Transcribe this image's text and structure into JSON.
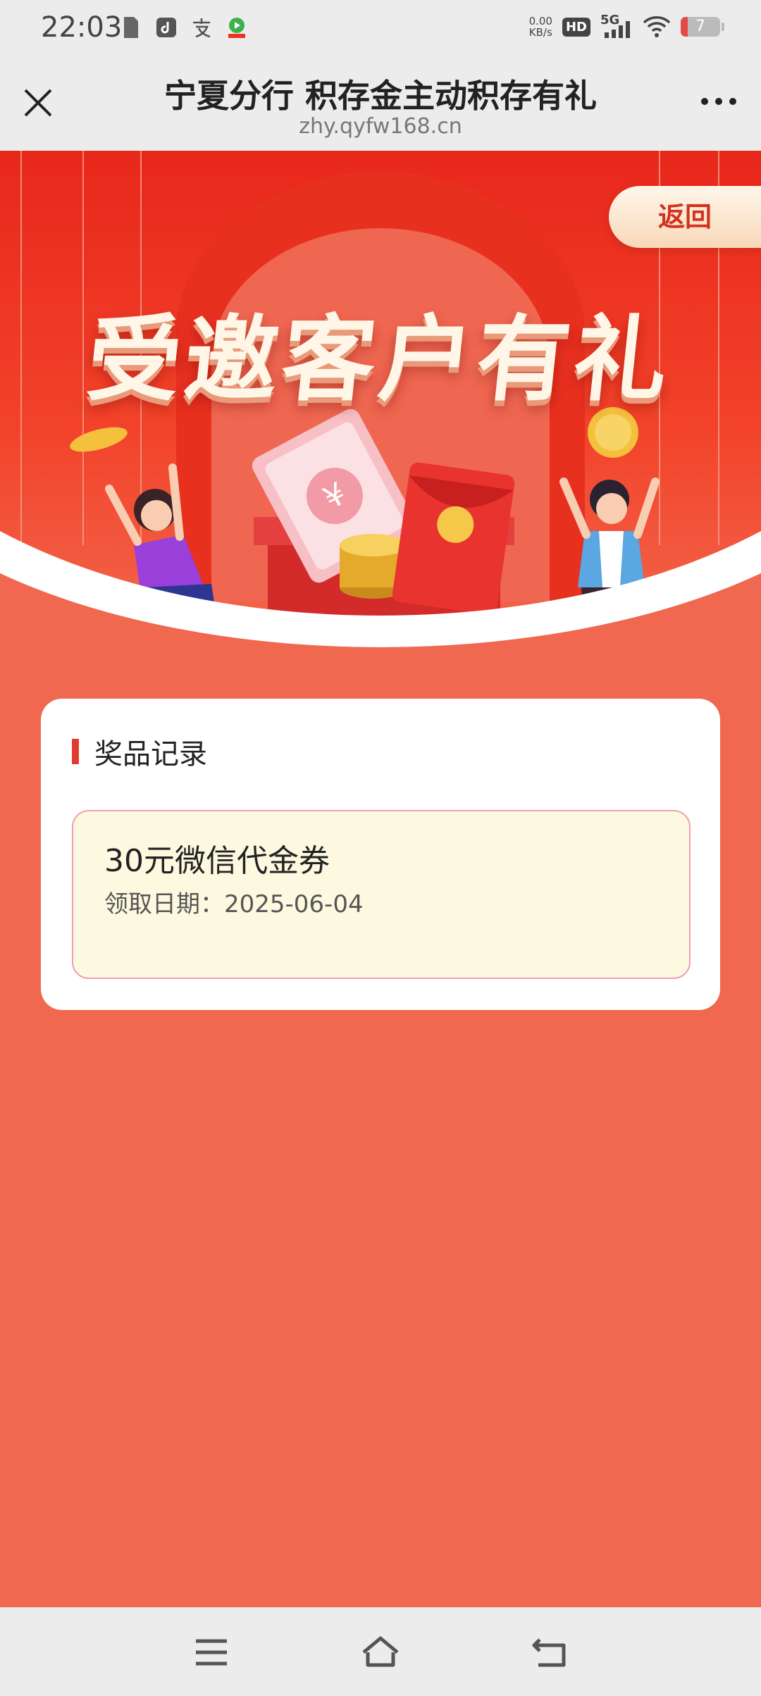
{
  "status_bar": {
    "time": "22:03",
    "net_speed_value": "0.00",
    "net_speed_unit": "KB/s",
    "hd_badge": "HD",
    "network": "5G",
    "battery": "7"
  },
  "nav": {
    "title": "宁夏分行 积存金主动积存有礼",
    "url": "zhy.qyfw168.cn"
  },
  "banner": {
    "back_label": "返回",
    "title": "受邀客户有礼",
    "coin_symbol": "¥"
  },
  "records": {
    "heading": "奖品记录",
    "items": [
      {
        "name": "30元微信代金券",
        "date": "领取日期：2025-06-04"
      }
    ]
  },
  "colors": {
    "banner_red": "#e8271b",
    "page_bg": "#f0684f",
    "card_bg": "#ffffff",
    "record_bg": "#fdf9e0",
    "record_border": "#f0a0b0",
    "accent_bar": "#e23b2e"
  }
}
